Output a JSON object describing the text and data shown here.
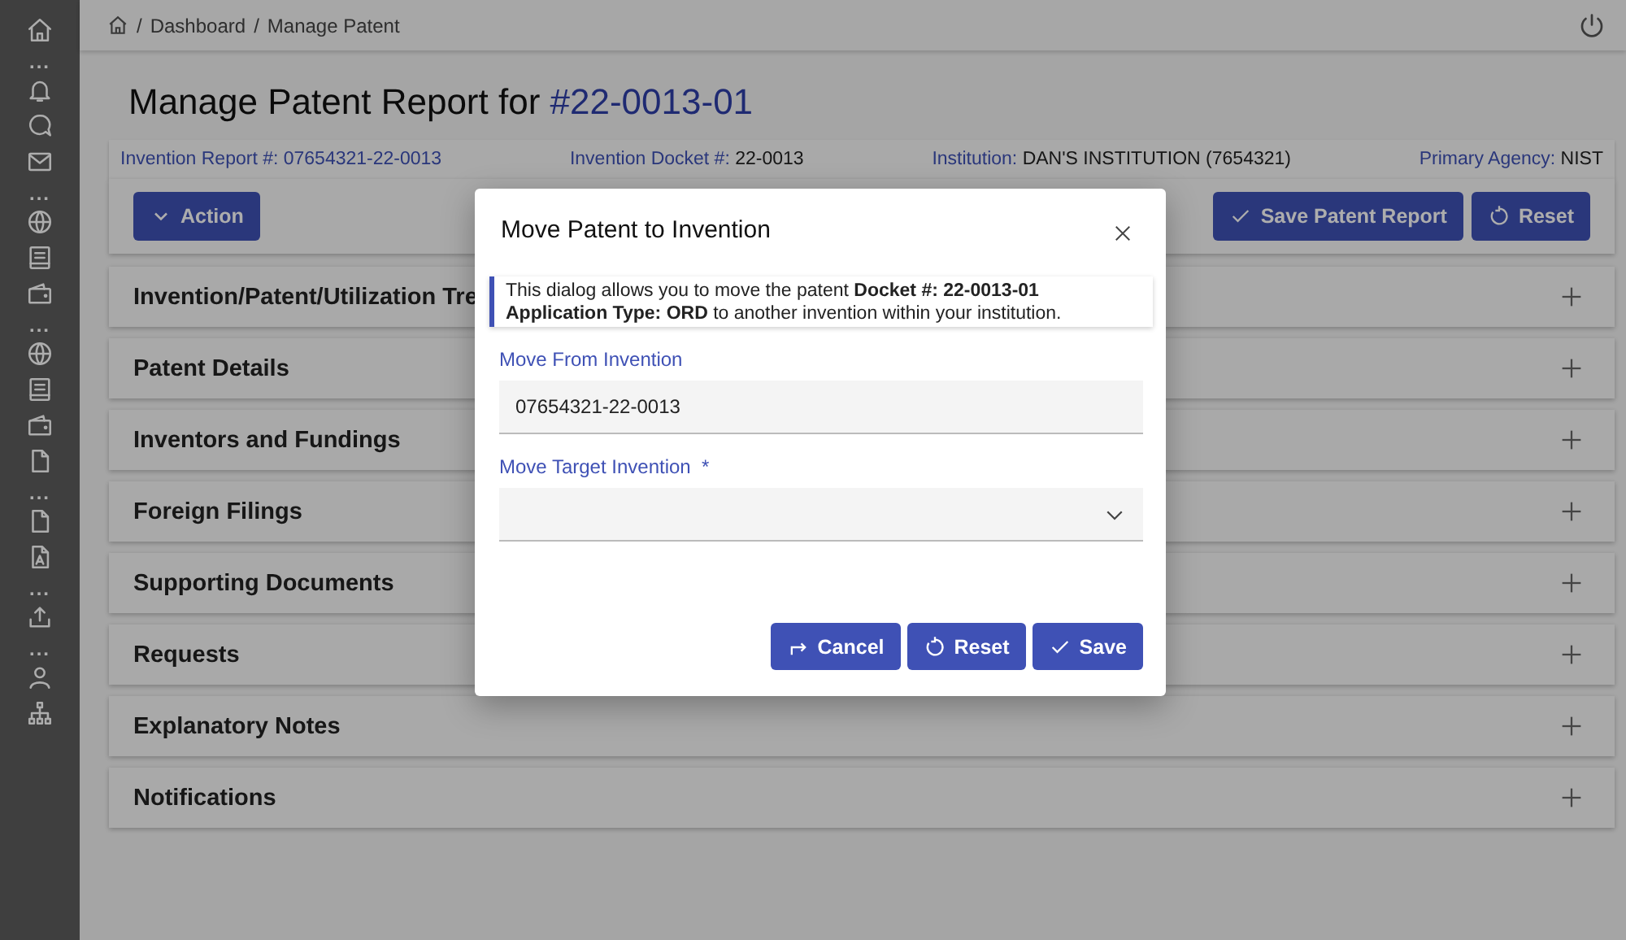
{
  "sidebar": {
    "items": [
      {
        "kind": "home"
      },
      {
        "kind": "more",
        "text": "..."
      },
      {
        "kind": "bell"
      },
      {
        "kind": "chat"
      },
      {
        "kind": "mail"
      },
      {
        "kind": "more",
        "text": "..."
      },
      {
        "kind": "globe"
      },
      {
        "kind": "list"
      },
      {
        "kind": "wallet"
      },
      {
        "kind": "more",
        "text": "..."
      },
      {
        "kind": "globe"
      },
      {
        "kind": "list"
      },
      {
        "kind": "wallet"
      },
      {
        "kind": "file"
      },
      {
        "kind": "more",
        "text": "..."
      },
      {
        "kind": "file"
      },
      {
        "kind": "pdf"
      },
      {
        "kind": "more",
        "text": "..."
      },
      {
        "kind": "upload"
      },
      {
        "kind": "more",
        "text": "..."
      },
      {
        "kind": "user"
      },
      {
        "kind": "sitemap"
      }
    ]
  },
  "breadcrumb": [
    {
      "separator": "/",
      "text": "Dashboard"
    },
    {
      "separator": "/",
      "text": "Manage Patent"
    }
  ],
  "page_title": {
    "prefix": "Manage Patent Report for ",
    "number": "#22-0013-01"
  },
  "info_bar": [
    {
      "label": "Invention Report #: ",
      "value": "07654321-22-0013",
      "link": true
    },
    {
      "label": "Invention Docket #: ",
      "value": "22-0013",
      "link": false
    },
    {
      "label": "Institution: ",
      "value": "DAN'S INSTITUTION (7654321)",
      "link": false
    },
    {
      "label": "Primary Agency: ",
      "value": "NIST",
      "link": false
    }
  ],
  "toolbar": {
    "action": "Action",
    "buttons": [
      {
        "kind": "save",
        "label": "Save Patent Report"
      },
      {
        "kind": "reset",
        "label": "Reset"
      }
    ]
  },
  "sections": [
    {
      "title": "Invention/Patent/Utilization Tre",
      "expanded": false
    },
    {
      "title": "Patent Details",
      "expanded": false
    },
    {
      "title": "Inventors and Fundings",
      "expanded": false
    },
    {
      "title": "Foreign Filings",
      "expanded": false
    },
    {
      "title": "Supporting Documents",
      "expanded": false
    },
    {
      "title": "Requests",
      "expanded": false
    },
    {
      "title": "Explanatory Notes",
      "expanded": false
    },
    {
      "title": "Notifications",
      "expanded": false
    }
  ],
  "dialog": {
    "title": "Move Patent to Invention",
    "message": "This dialog allows you to move the patent **Docket #: 22-0013-01** **Application Type: ORD** to another invention within your institution.",
    "from_field": {
      "label": "Move From Invention",
      "value": "07654321-22-0013"
    },
    "target_field": {
      "label": "Move Target Invention",
      "required_mark": "*"
    },
    "buttons": [
      {
        "kind": "cancel",
        "label": "Cancel"
      },
      {
        "kind": "reset",
        "label": "Reset"
      },
      {
        "kind": "save",
        "label": "Save"
      }
    ]
  }
}
